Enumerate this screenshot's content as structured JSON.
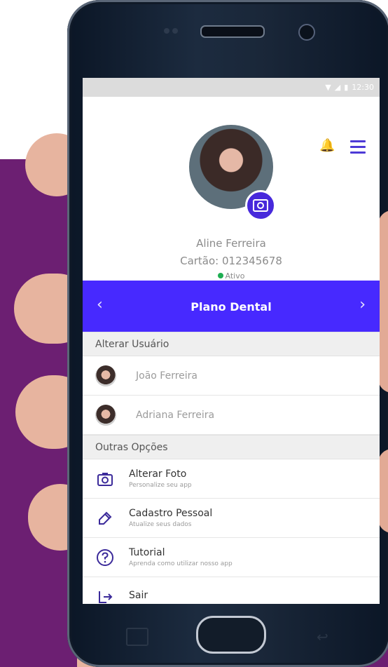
{
  "statusbar": {
    "time": "12:30",
    "wifi_icon": "wifi-icon",
    "signal_icon": "signal-icon",
    "battery_icon": "battery-icon"
  },
  "profile": {
    "name": "Aline Ferreira",
    "card": "Cartão: 012345678",
    "status": "Ativo",
    "bell_icon": "bell-icon",
    "menu_icon": "menu-icon"
  },
  "plan": {
    "title": "Plano Dental",
    "prev_icon": "chevron-left-icon",
    "next_icon": "chevron-right-icon",
    "accent": "#4729ff"
  },
  "users_section": {
    "title": "Alterar Usuário",
    "users": [
      {
        "name": "João Ferreira"
      },
      {
        "name": "Adriana Ferreira"
      }
    ]
  },
  "options_section": {
    "title": "Outras Opções",
    "items": [
      {
        "title": "Alterar Foto",
        "subtitle": "Personalize seu app",
        "icon": "camera-icon"
      },
      {
        "title": "Cadastro Pessoal",
        "subtitle": "Atualize seus dados",
        "icon": "edit-icon"
      },
      {
        "title": "Tutorial",
        "subtitle": "Aprenda como utilizar nosso app",
        "icon": "help-icon"
      },
      {
        "title": "Sair",
        "subtitle": "",
        "icon": "logout-icon"
      }
    ]
  },
  "colors": {
    "background_purple": "#6c1f72",
    "accent_blue": "#4729ff",
    "status_green": "#1fae52"
  }
}
